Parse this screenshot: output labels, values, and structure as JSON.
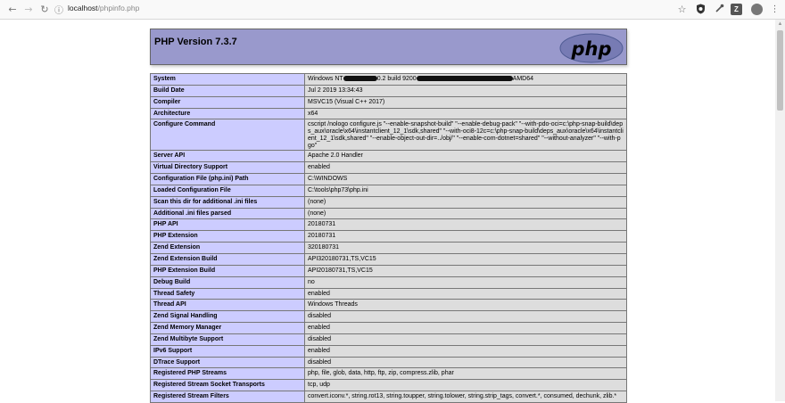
{
  "browser": {
    "url_host": "localhost",
    "url_path": "/phpinfo.php",
    "extension_labels": [
      "Z"
    ]
  },
  "page": {
    "title": "PHP Version 7.3.7",
    "logo_text": "php"
  },
  "rows": [
    {
      "label": "System",
      "value_prefix": "Windows NT",
      "value_mid": "0.2 build 9200",
      "value_suffix": "AMD64"
    },
    {
      "label": "Build Date",
      "value": "Jul 2 2019 13:34:43"
    },
    {
      "label": "Compiler",
      "value": "MSVC15 (Visual C++ 2017)"
    },
    {
      "label": "Architecture",
      "value": "x64"
    },
    {
      "label": "Configure Command",
      "value": "cscript /nologo configure.js \"--enable-snapshot-build\" \"--enable-debug-pack\" \"--with-pdo-oci=c:\\php-snap-build\\deps_aux\\oracle\\x64\\instantclient_12_1\\sdk,shared\" \"--with-oci8-12c=c:\\php-snap-build\\deps_aux\\oracle\\x64\\instantclient_12_1\\sdk,shared\" \"--enable-object-out-dir=../obj/\" \"--enable-com-dotnet=shared\" \"--without-analyzer\" \"--with-pgo\""
    },
    {
      "label": "Server API",
      "value": "Apache 2.0 Handler"
    },
    {
      "label": "Virtual Directory Support",
      "value": "enabled"
    },
    {
      "label": "Configuration File (php.ini) Path",
      "value": "C:\\WINDOWS"
    },
    {
      "label": "Loaded Configuration File",
      "value": "C:\\tools\\php73\\php.ini"
    },
    {
      "label": "Scan this dir for additional .ini files",
      "value": "(none)"
    },
    {
      "label": "Additional .ini files parsed",
      "value": "(none)"
    },
    {
      "label": "PHP API",
      "value": "20180731"
    },
    {
      "label": "PHP Extension",
      "value": "20180731"
    },
    {
      "label": "Zend Extension",
      "value": "320180731"
    },
    {
      "label": "Zend Extension Build",
      "value": "API320180731,TS,VC15"
    },
    {
      "label": "PHP Extension Build",
      "value": "API20180731,TS,VC15"
    },
    {
      "label": "Debug Build",
      "value": "no"
    },
    {
      "label": "Thread Safety",
      "value": "enabled"
    },
    {
      "label": "Thread API",
      "value": "Windows Threads"
    },
    {
      "label": "Zend Signal Handling",
      "value": "disabled"
    },
    {
      "label": "Zend Memory Manager",
      "value": "enabled"
    },
    {
      "label": "Zend Multibyte Support",
      "value": "disabled"
    },
    {
      "label": "IPv6 Support",
      "value": "enabled"
    },
    {
      "label": "DTrace Support",
      "value": "disabled"
    },
    {
      "label": "Registered PHP Streams",
      "value": "php, file, glob, data, http, ftp, zip, compress.zlib, phar"
    },
    {
      "label": "Registered Stream Socket Transports",
      "value": "tcp, udp"
    },
    {
      "label": "Registered Stream Filters",
      "value": "convert.iconv.*, string.rot13, string.toupper, string.tolower, string.strip_tags, convert.*, consumed, dechunk, zlib.*"
    }
  ],
  "icons": {
    "back": "back-arrow-icon",
    "forward": "forward-arrow-icon",
    "reload": "reload-icon",
    "info": "info-icon",
    "star": "star-icon",
    "shield": "shield-extension-icon",
    "eyedropper": "eyedropper-icon",
    "puzzle": "extension-icon",
    "profile": "profile-avatar-icon",
    "menu": "menu-dots-icon"
  },
  "colors": {
    "header_bg": "#9999cc",
    "label_bg": "#ccccff",
    "value_bg": "#dddddd"
  }
}
